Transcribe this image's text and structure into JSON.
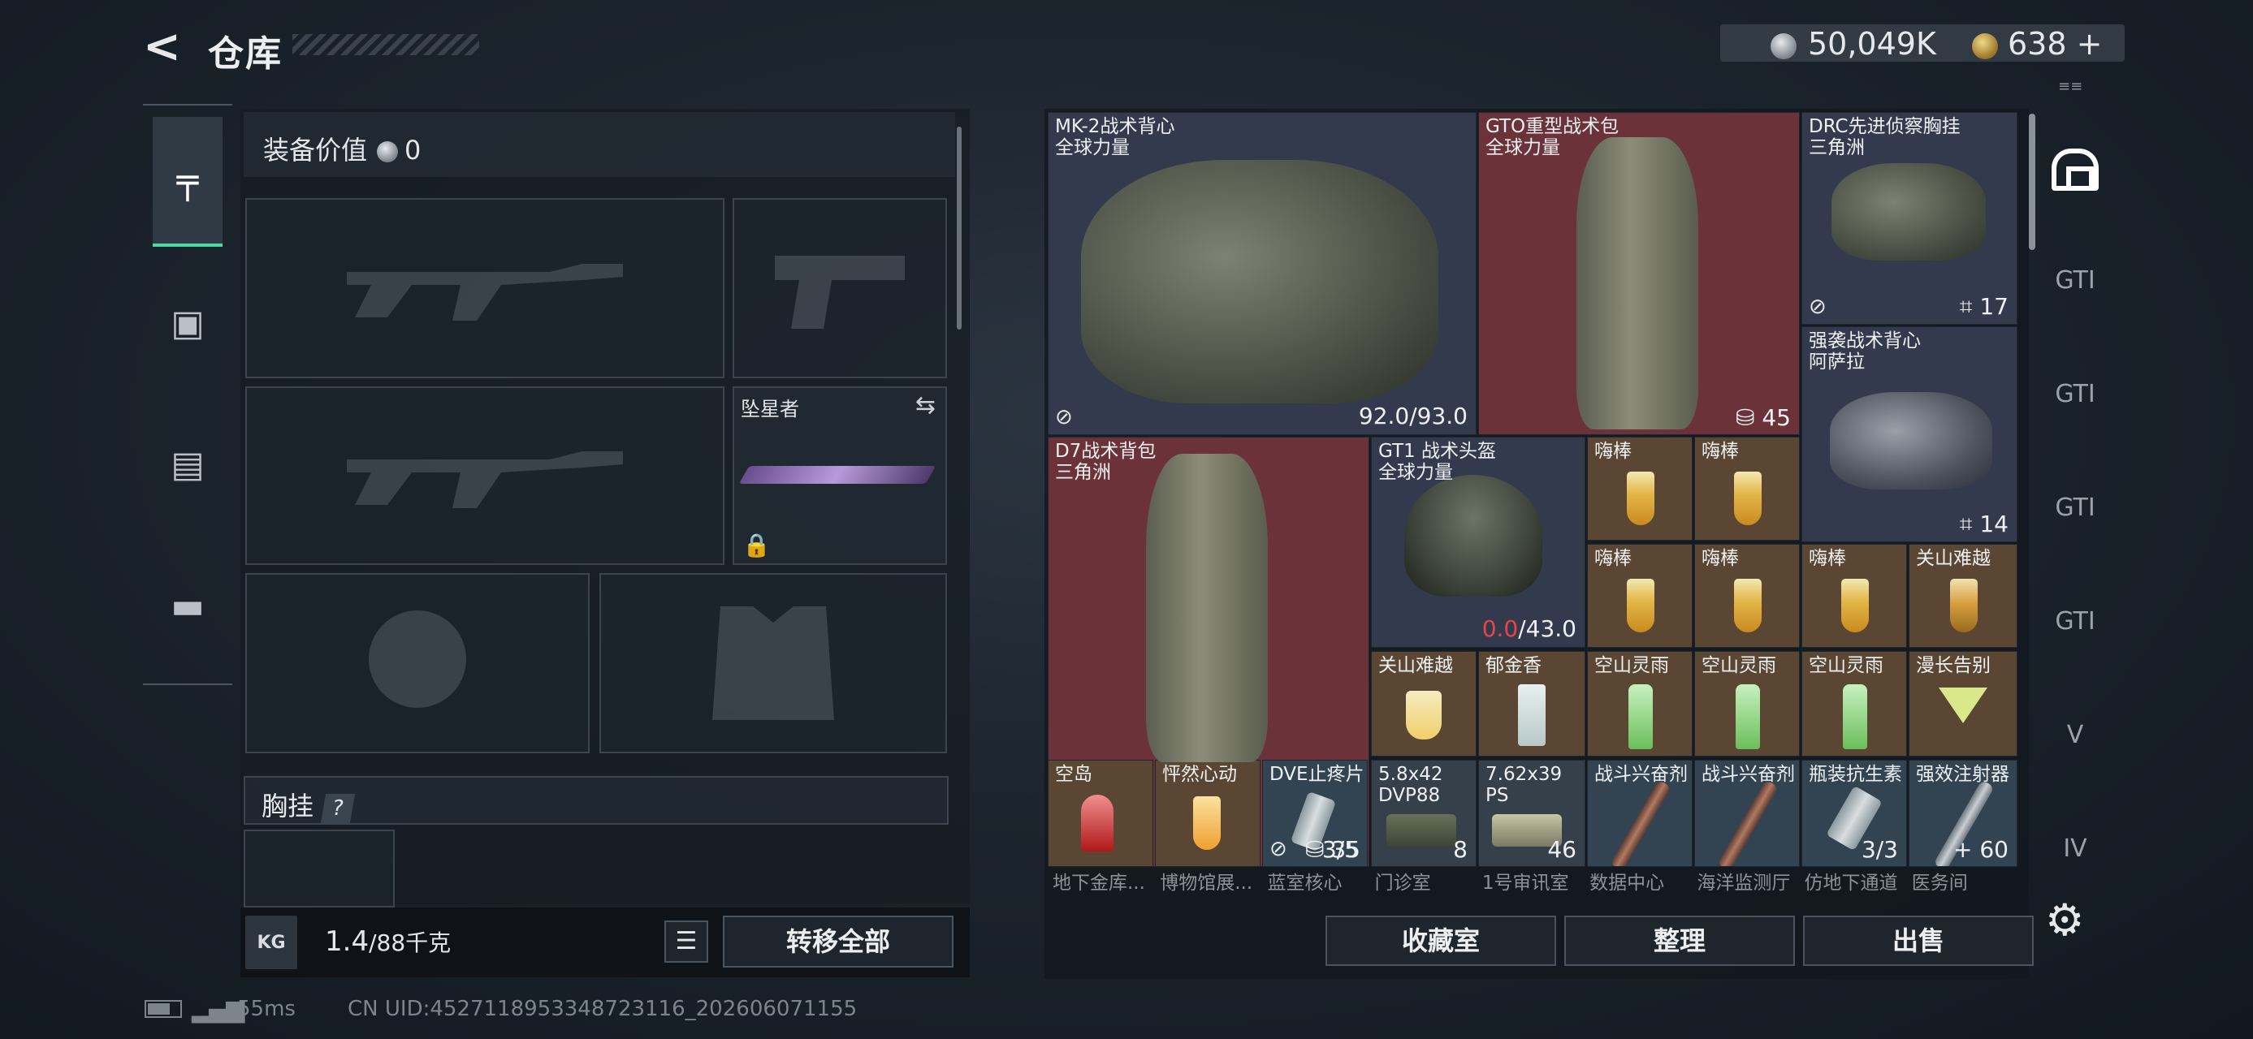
{
  "header": {
    "title": "仓库",
    "currency": {
      "silver": "50,049K",
      "gold": "638",
      "gold_add": "+"
    }
  },
  "left_nav": {
    "icons": [
      "pistol-icon",
      "armor-icon",
      "backpack-icon",
      "toolbox-icon"
    ]
  },
  "equipment": {
    "value_label": "装备价值",
    "value": "0",
    "named_slot_label": "坠星者",
    "chest_label": "胸挂",
    "chest_help": "?",
    "weight": "1.4",
    "weight_max": "/88",
    "weight_unit": "千克",
    "kg_badge": "KG",
    "transfer_all": "转移全部"
  },
  "inventory": {
    "mk2": {
      "name": "MK-2战术背心",
      "sub": "全球力量",
      "value": "92.0/93.0"
    },
    "gt0": {
      "name": "GTO重型战术包",
      "sub": "全球力量",
      "value": "45"
    },
    "drc": {
      "name": "DRC先进侦察胸挂",
      "sub": "三角洲",
      "value": "17"
    },
    "qx": {
      "name": "强袭战术背心",
      "sub": "阿萨拉",
      "value": "14"
    },
    "d7": {
      "name": "D7战术背包",
      "sub": "三角洲",
      "value": "35"
    },
    "gt1": {
      "name": "GT1 战术头盔",
      "sub": "全球力量",
      "value_red": "0.0",
      "value_rest": "/43.0"
    },
    "drinks_row1": [
      "嗨棒",
      "嗨棒"
    ],
    "drinks_row2": [
      "嗨棒",
      "嗨棒",
      "嗨棒",
      "关山难越"
    ],
    "drinks_row3": [
      "关山难越",
      "郁金香",
      "空山灵雨",
      "空山灵雨",
      "空山灵雨",
      "漫长告别"
    ],
    "row4": {
      "kongdao": "空岛",
      "pingran": "怦然心动",
      "dve": {
        "name": "DVE止疼片",
        "count": "3/5"
      },
      "ammo1": {
        "name": "5.8x42",
        "name2": "DVP88",
        "count": "8"
      },
      "ammo2": {
        "name": "7.62x39",
        "name2": "PS",
        "count": "46"
      },
      "stim1": "战斗兴奋剂",
      "stim2": "战斗兴奋剂",
      "anti": {
        "name": "瓶装抗生素",
        "count": "3/3"
      },
      "inject": {
        "name": "强效注射器",
        "count": "60",
        "plus": "+"
      }
    },
    "row_labels": [
      "地下金库...",
      "博物馆展...",
      "蓝室核心",
      "门诊室",
      "1号审讯室",
      "数据中心",
      "海洋监测厅",
      "仿地下通道",
      "医务间"
    ]
  },
  "right_sidebar": {
    "labels": [
      "GTI",
      "GTI",
      "GTI",
      "GTI",
      "V",
      "IV"
    ]
  },
  "buttons": {
    "collection": "收藏室",
    "sort": "整理",
    "sell": "出售"
  },
  "status": {
    "ping": "55ms",
    "uid": "CN UID:4527118953348723116_202606071155"
  },
  "colors": {
    "accent": "#4fd6a5",
    "red_value": "#e04848",
    "navy_cell": "#343a4e",
    "red_cell": "#6b3339",
    "brown_cell": "#5a4632",
    "teal_cell": "#324452"
  }
}
